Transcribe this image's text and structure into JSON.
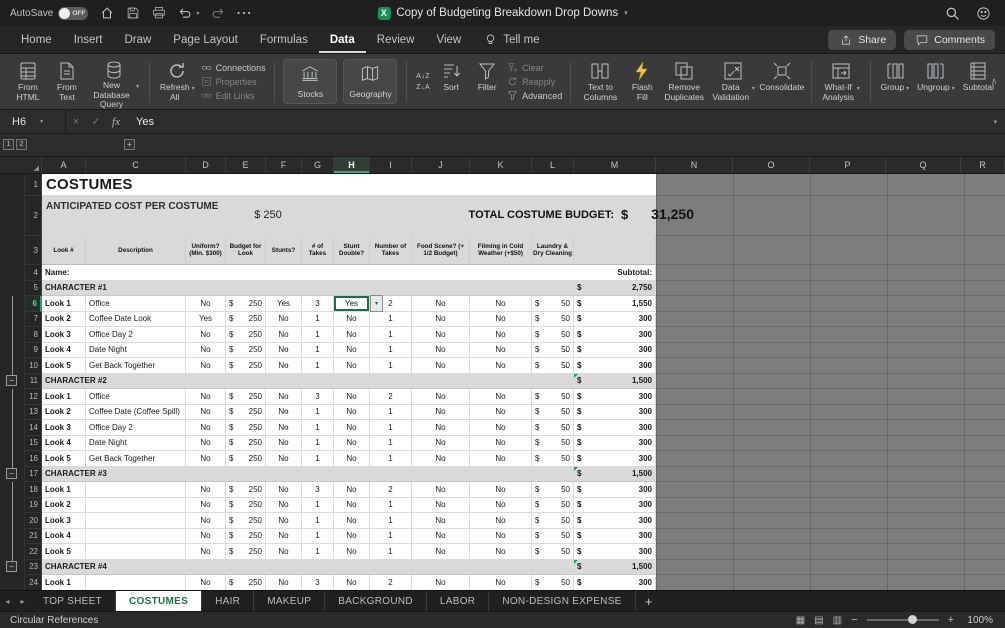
{
  "glyphs": {
    "caret": "▾",
    "collapse": "∧",
    "prev": "◂",
    "next": "▸",
    "x": "×",
    "check": "✓",
    "dots": "⋯",
    "corner": "◢",
    "view_normal": "▦",
    "view_layout": "▤",
    "view_break": "▥",
    "zoom_minus": "−",
    "zoom_plus": "+"
  },
  "titlebar": {
    "autosave_label": "AutoSave",
    "autosave_state": "OFF",
    "doc_title": "Copy of Budgeting Breakdown Drop Downs"
  },
  "ribbon": {
    "tabs": [
      {
        "label": "Home"
      },
      {
        "label": "Insert"
      },
      {
        "label": "Draw"
      },
      {
        "label": "Page Layout"
      },
      {
        "label": "Formulas"
      },
      {
        "label": "Data",
        "active": true
      },
      {
        "label": "Review"
      },
      {
        "label": "View"
      }
    ],
    "tell_me": "Tell me",
    "share_label": "Share",
    "comments_label": "Comments",
    "buttons": {
      "from_html": "From HTML",
      "from_text": "From Text",
      "new_database_query": "New Database Query",
      "refresh_all": "Refresh All",
      "connections": "Connections",
      "properties": "Properties",
      "edit_links": "Edit Links",
      "stocks": "Stocks",
      "geography": "Geography",
      "sort_az": "A↓Z",
      "sort_za": "Z↓A",
      "sort": "Sort",
      "filter": "Filter",
      "clear": "Clear",
      "reapply": "Reapply",
      "advanced": "Advanced",
      "text_to_columns": "Text to Columns",
      "flash_fill": "Flash Fill",
      "remove_duplicates": "Remove Duplicates",
      "data_validation": "Data Validation",
      "consolidate": "Consolidate",
      "what_if": "What-If Analysis",
      "group": "Group",
      "ungroup": "Ungroup",
      "subtotal": "Subtotal"
    }
  },
  "formula_bar": {
    "cell_ref": "H6",
    "fx_label": "fx",
    "value": "Yes"
  },
  "outline": {
    "level1": "1",
    "level2": "2",
    "col_button": "+",
    "collapse_glyph": "−"
  },
  "grid": {
    "columns": [
      "A",
      "C",
      "D",
      "E",
      "F",
      "G",
      "H",
      "I",
      "J",
      "K",
      "L",
      "M",
      "N",
      "O",
      "P",
      "Q",
      "R"
    ],
    "selected_column": "H",
    "selected_row": "6"
  },
  "sheet": {
    "dollar": "$",
    "rows": [
      {
        "type": "title",
        "n": "1",
        "title": "COSTUMES"
      },
      {
        "type": "banner",
        "n": "2",
        "ant_label": "ANTICIPATED COST PER COSTUME",
        "ant_value": "$ 250",
        "total_label": "TOTAL COSTUME BUDGET:",
        "total_d": "$",
        "total": "31,250"
      },
      {
        "type": "head",
        "n": "3",
        "headers": [
          "Look #",
          "Description",
          "Uniform? (Min. $300)",
          "Budget for Look",
          "Stunts?",
          "# of Takes",
          "Stunt Double?",
          "Number of Takes",
          "Food Scene? (+ 1/2 Budget)",
          "Filming in Cold Weather (+$50)",
          "Laundry & Dry Cleaning",
          ""
        ]
      },
      {
        "type": "name",
        "n": "4",
        "label": "Name:",
        "sub": "Subtotal:"
      },
      {
        "type": "char",
        "n": "5",
        "label": "CHARACTER #1",
        "sub": "2,750",
        "tri": false
      },
      {
        "type": "look",
        "n": "6",
        "look": "Look 1",
        "desc": "Office",
        "uni": "No",
        "bud": "250",
        "stu": "Yes",
        "tak": "3",
        "dbl": "Yes",
        "ntk": "2",
        "food": "No",
        "cold": "No",
        "lau": "50",
        "sub": "1,550",
        "sel": true
      },
      {
        "type": "look",
        "n": "7",
        "look": "Look 2",
        "desc": "Coffee Date Look",
        "uni": "Yes",
        "bud": "250",
        "stu": "No",
        "tak": "1",
        "dbl": "No",
        "ntk": "1",
        "food": "No",
        "cold": "No",
        "lau": "50",
        "sub": "300"
      },
      {
        "type": "look",
        "n": "8",
        "look": "Look 3",
        "desc": "Office Day 2",
        "uni": "No",
        "bud": "250",
        "stu": "No",
        "tak": "1",
        "dbl": "No",
        "ntk": "1",
        "food": "No",
        "cold": "No",
        "lau": "50",
        "sub": "300"
      },
      {
        "type": "look",
        "n": "9",
        "look": "Look 4",
        "desc": "Date Night",
        "uni": "No",
        "bud": "250",
        "stu": "No",
        "tak": "1",
        "dbl": "No",
        "ntk": "1",
        "food": "No",
        "cold": "No",
        "lau": "50",
        "sub": "300"
      },
      {
        "type": "look",
        "n": "10",
        "look": "Look 5",
        "desc": "Get Back Together",
        "uni": "No",
        "bud": "250",
        "stu": "No",
        "tak": "1",
        "dbl": "No",
        "ntk": "1",
        "food": "No",
        "cold": "No",
        "lau": "50",
        "sub": "300"
      },
      {
        "type": "char",
        "n": "11",
        "label": "CHARACTER #2",
        "sub": "1,500",
        "tri": true
      },
      {
        "type": "look",
        "n": "12",
        "look": "Look 1",
        "desc": "Office",
        "uni": "No",
        "bud": "250",
        "stu": "No",
        "tak": "3",
        "dbl": "No",
        "ntk": "2",
        "food": "No",
        "cold": "No",
        "lau": "50",
        "sub": "300"
      },
      {
        "type": "look",
        "n": "13",
        "look": "Look 2",
        "desc": "Coffee Date (Coffee Spill)",
        "uni": "No",
        "bud": "250",
        "stu": "No",
        "tak": "1",
        "dbl": "No",
        "ntk": "1",
        "food": "No",
        "cold": "No",
        "lau": "50",
        "sub": "300"
      },
      {
        "type": "look",
        "n": "14",
        "look": "Look 3",
        "desc": "Office Day 2",
        "uni": "No",
        "bud": "250",
        "stu": "No",
        "tak": "1",
        "dbl": "No",
        "ntk": "1",
        "food": "No",
        "cold": "No",
        "lau": "50",
        "sub": "300"
      },
      {
        "type": "look",
        "n": "15",
        "look": "Look 4",
        "desc": "Date Night",
        "uni": "No",
        "bud": "250",
        "stu": "No",
        "tak": "1",
        "dbl": "No",
        "ntk": "1",
        "food": "No",
        "cold": "No",
        "lau": "50",
        "sub": "300"
      },
      {
        "type": "look",
        "n": "16",
        "look": "Look 5",
        "desc": "Get Back Together",
        "uni": "No",
        "bud": "250",
        "stu": "No",
        "tak": "1",
        "dbl": "No",
        "ntk": "1",
        "food": "No",
        "cold": "No",
        "lau": "50",
        "sub": "300"
      },
      {
        "type": "char",
        "n": "17",
        "label": "CHARACTER #3",
        "sub": "1,500",
        "tri": true
      },
      {
        "type": "look",
        "n": "18",
        "look": "Look 1",
        "desc": "",
        "uni": "No",
        "bud": "250",
        "stu": "No",
        "tak": "3",
        "dbl": "No",
        "ntk": "2",
        "food": "No",
        "cold": "No",
        "lau": "50",
        "sub": "300"
      },
      {
        "type": "look",
        "n": "19",
        "look": "Look 2",
        "desc": "",
        "uni": "No",
        "bud": "250",
        "stu": "No",
        "tak": "1",
        "dbl": "No",
        "ntk": "1",
        "food": "No",
        "cold": "No",
        "lau": "50",
        "sub": "300"
      },
      {
        "type": "look",
        "n": "20",
        "look": "Look 3",
        "desc": "",
        "uni": "No",
        "bud": "250",
        "stu": "No",
        "tak": "1",
        "dbl": "No",
        "ntk": "1",
        "food": "No",
        "cold": "No",
        "lau": "50",
        "sub": "300"
      },
      {
        "type": "look",
        "n": "21",
        "look": "Look 4",
        "desc": "",
        "uni": "No",
        "bud": "250",
        "stu": "No",
        "tak": "1",
        "dbl": "No",
        "ntk": "1",
        "food": "No",
        "cold": "No",
        "lau": "50",
        "sub": "300"
      },
      {
        "type": "look",
        "n": "22",
        "look": "Look 5",
        "desc": "",
        "uni": "No",
        "bud": "250",
        "stu": "No",
        "tak": "1",
        "dbl": "No",
        "ntk": "1",
        "food": "No",
        "cold": "No",
        "lau": "50",
        "sub": "300"
      },
      {
        "type": "char",
        "n": "23",
        "label": "CHARACTER #4",
        "sub": "1,500",
        "tri": true
      },
      {
        "type": "look",
        "n": "24",
        "look": "Look 1",
        "desc": "",
        "uni": "No",
        "bud": "250",
        "stu": "No",
        "tak": "3",
        "dbl": "No",
        "ntk": "2",
        "food": "No",
        "cold": "No",
        "lau": "50",
        "sub": "300"
      }
    ]
  },
  "sheet_tabs": {
    "items": [
      {
        "label": "TOP SHEET"
      },
      {
        "label": "COSTUMES",
        "active": true
      },
      {
        "label": "HAIR"
      },
      {
        "label": "MAKEUP"
      },
      {
        "label": "BACKGROUND"
      },
      {
        "label": "LABOR"
      },
      {
        "label": "NON-DESIGN EXPENSE"
      }
    ],
    "add_label": "+"
  },
  "status_bar": {
    "left": "Circular References",
    "zoom": "100%"
  }
}
